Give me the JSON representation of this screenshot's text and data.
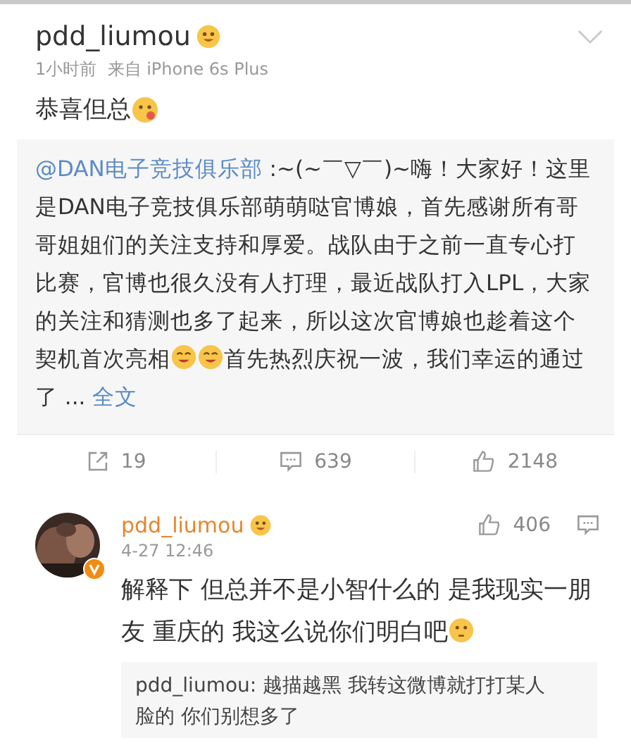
{
  "post": {
    "author": "pdd_liumou",
    "meta": "1小时前  来自 iPhone 6s Plus",
    "text": [
      {
        "kind": "text",
        "text": "恭喜但总"
      },
      {
        "kind": "emoji"
      }
    ]
  },
  "quote": {
    "segments": [
      {
        "kind": "mention",
        "text": "@DAN电子竞技俱乐部"
      },
      {
        "kind": "text",
        "text": " :~(~￣▽￣)~嗨！大家好！这里是DAN电子竞技俱乐部萌萌哒官博娘，首先感谢所有哥哥姐姐们的关注支持和厚爱。战队由于之前一直专心打比赛，官博也很久没有人打理，最近战队打入LPL，大家的关注和猜测也多了起来，所以这次官博娘也趁着这个契机首次亮相"
      },
      {
        "kind": "emoji"
      },
      {
        "kind": "emoji"
      },
      {
        "kind": "text",
        "text": "首先热烈庆祝一波，我们幸运的通过了 ... "
      },
      {
        "kind": "link",
        "text": "全文"
      }
    ]
  },
  "actions": [
    {
      "kind": "repost",
      "count": "19"
    },
    {
      "kind": "comment",
      "count": "639"
    },
    {
      "kind": "like",
      "count": "2148"
    }
  ],
  "comment": {
    "author": "pdd_liumou",
    "verified": true,
    "time": "4-27 12:46",
    "likes": "406",
    "text": [
      {
        "kind": "text",
        "text": "解释下 但总并不是小智什么的 是我现实一朋友 重庆的 我这么说你们明白吧"
      },
      {
        "kind": "emoji"
      }
    ],
    "reply": "pdd_liumou: 越描越黑 我转这微博就打打某人脸的 你们别想多了"
  }
}
